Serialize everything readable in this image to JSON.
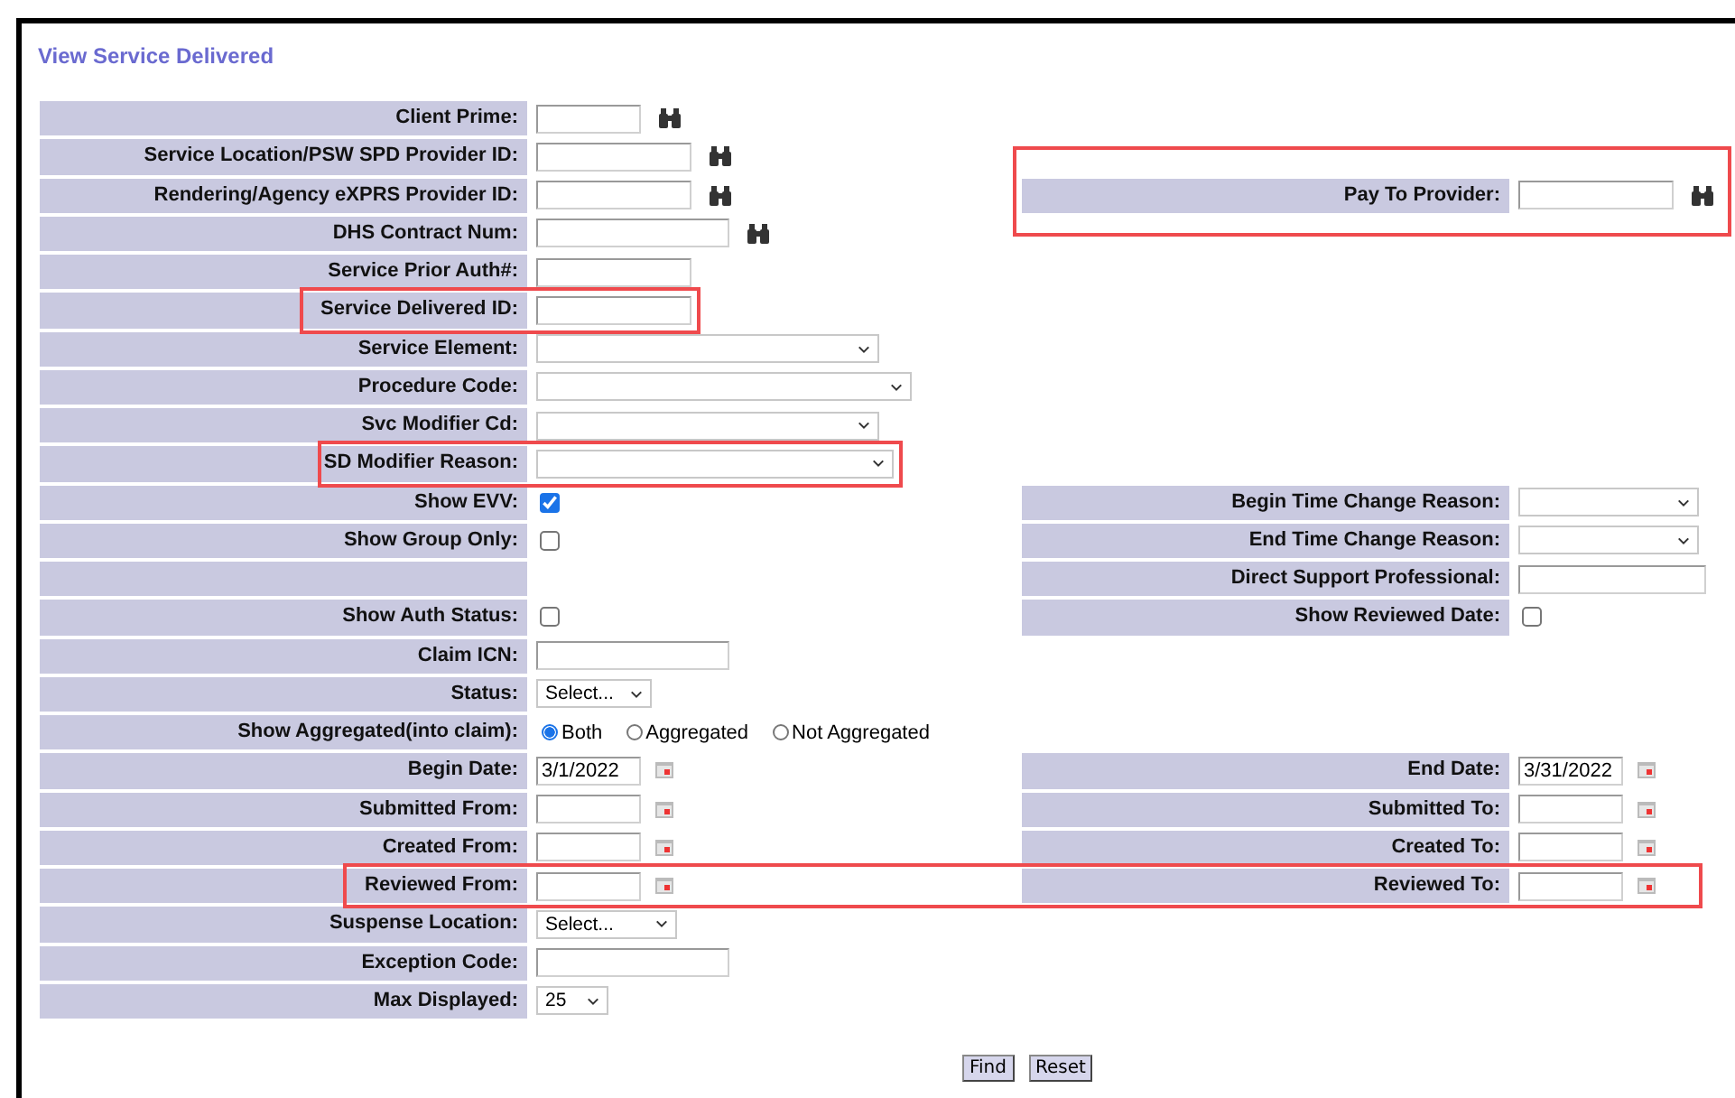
{
  "title": "View Service Delivered",
  "rows": [
    {
      "left": {
        "label": "Client Prime:",
        "control": {
          "kind": "text",
          "lookup": true
        }
      }
    },
    {
      "left": {
        "label": "Service Location/PSW SPD Provider ID:",
        "control": {
          "kind": "text",
          "lookup": true
        }
      }
    },
    {
      "left": {
        "label": "Rendering/Agency eXPRS Provider ID:",
        "control": {
          "kind": "text",
          "lookup": true
        }
      },
      "right": {
        "label": "Pay To Provider:",
        "control": {
          "kind": "text",
          "lookup": true
        },
        "highlighted": true
      }
    },
    {
      "left": {
        "label": "DHS Contract Num:",
        "control": {
          "kind": "text",
          "lookup": true
        }
      }
    },
    {
      "left": {
        "label": "Service Prior Auth#:",
        "control": {
          "kind": "text",
          "lookup": false
        }
      }
    },
    {
      "left": {
        "label": "Service Delivered ID:",
        "control": {
          "kind": "text",
          "lookup": false
        },
        "highlighted": true
      }
    },
    {
      "left": {
        "label": "Service Element:",
        "control": {
          "kind": "select"
        }
      }
    },
    {
      "left": {
        "label": "Procedure Code:",
        "control": {
          "kind": "select"
        }
      }
    },
    {
      "left": {
        "label": "Svc Modifier Cd:",
        "control": {
          "kind": "select"
        }
      }
    },
    {
      "left": {
        "label": "SD Modifier Reason:",
        "control": {
          "kind": "select"
        },
        "highlighted": true
      }
    },
    {
      "left": {
        "label": "Show EVV:",
        "control": {
          "kind": "checkbox",
          "checked": true
        }
      },
      "right": {
        "label": "Begin Time Change Reason:",
        "control": {
          "kind": "select"
        }
      }
    },
    {
      "left": {
        "label": "Show Group Only:",
        "control": {
          "kind": "checkbox",
          "checked": false
        }
      },
      "right": {
        "label": "End Time Change Reason:",
        "control": {
          "kind": "select"
        }
      }
    },
    {
      "left": {},
      "right": {
        "label": "Direct Support Professional:",
        "control": {
          "kind": "text",
          "lookup": false
        }
      }
    },
    {
      "left": {
        "label": "Show Auth Status:",
        "control": {
          "kind": "checkbox",
          "checked": false
        }
      },
      "right": {
        "label": "Show Reviewed Date:",
        "control": {
          "kind": "checkbox",
          "checked": false
        }
      }
    },
    {
      "left": {
        "label": "Claim ICN:",
        "control": {
          "kind": "text",
          "lookup": false
        }
      }
    },
    {
      "left": {
        "label": "Status:",
        "control": {
          "kind": "select",
          "value": "Select..."
        }
      }
    },
    {
      "left": {
        "label": "Show Aggregated(into claim):",
        "control": {
          "kind": "radio",
          "options": [
            {
              "label": "Both",
              "selected": true
            },
            {
              "label": "Aggregated",
              "selected": false
            },
            {
              "label": "Not Aggregated",
              "selected": false
            }
          ]
        }
      }
    },
    {
      "left": {
        "label": "Begin Date:",
        "control": {
          "kind": "date",
          "value": "3/1/2022"
        }
      },
      "right": {
        "label": "End Date:",
        "control": {
          "kind": "date",
          "value": "3/31/2022"
        }
      }
    },
    {
      "left": {
        "label": "Submitted From:",
        "control": {
          "kind": "date"
        }
      },
      "right": {
        "label": "Submitted To:",
        "control": {
          "kind": "date"
        }
      }
    },
    {
      "left": {
        "label": "Created From:",
        "control": {
          "kind": "date"
        }
      },
      "right": {
        "label": "Created To:",
        "control": {
          "kind": "date"
        }
      }
    },
    {
      "left": {
        "label": "Reviewed From:",
        "control": {
          "kind": "date"
        },
        "highlighted": true
      },
      "right": {
        "label": "Reviewed To:",
        "control": {
          "kind": "date"
        },
        "highlighted": true
      }
    },
    {
      "left": {
        "label": "Suspense Location:",
        "control": {
          "kind": "select",
          "value": "Select..."
        }
      }
    },
    {
      "left": {
        "label": "Exception Code:",
        "control": {
          "kind": "text",
          "lookup": false
        }
      }
    },
    {
      "left": {
        "label": "Max Displayed:",
        "control": {
          "kind": "select",
          "value": "25"
        }
      }
    }
  ],
  "buttons": [
    "Find",
    "Reset"
  ]
}
